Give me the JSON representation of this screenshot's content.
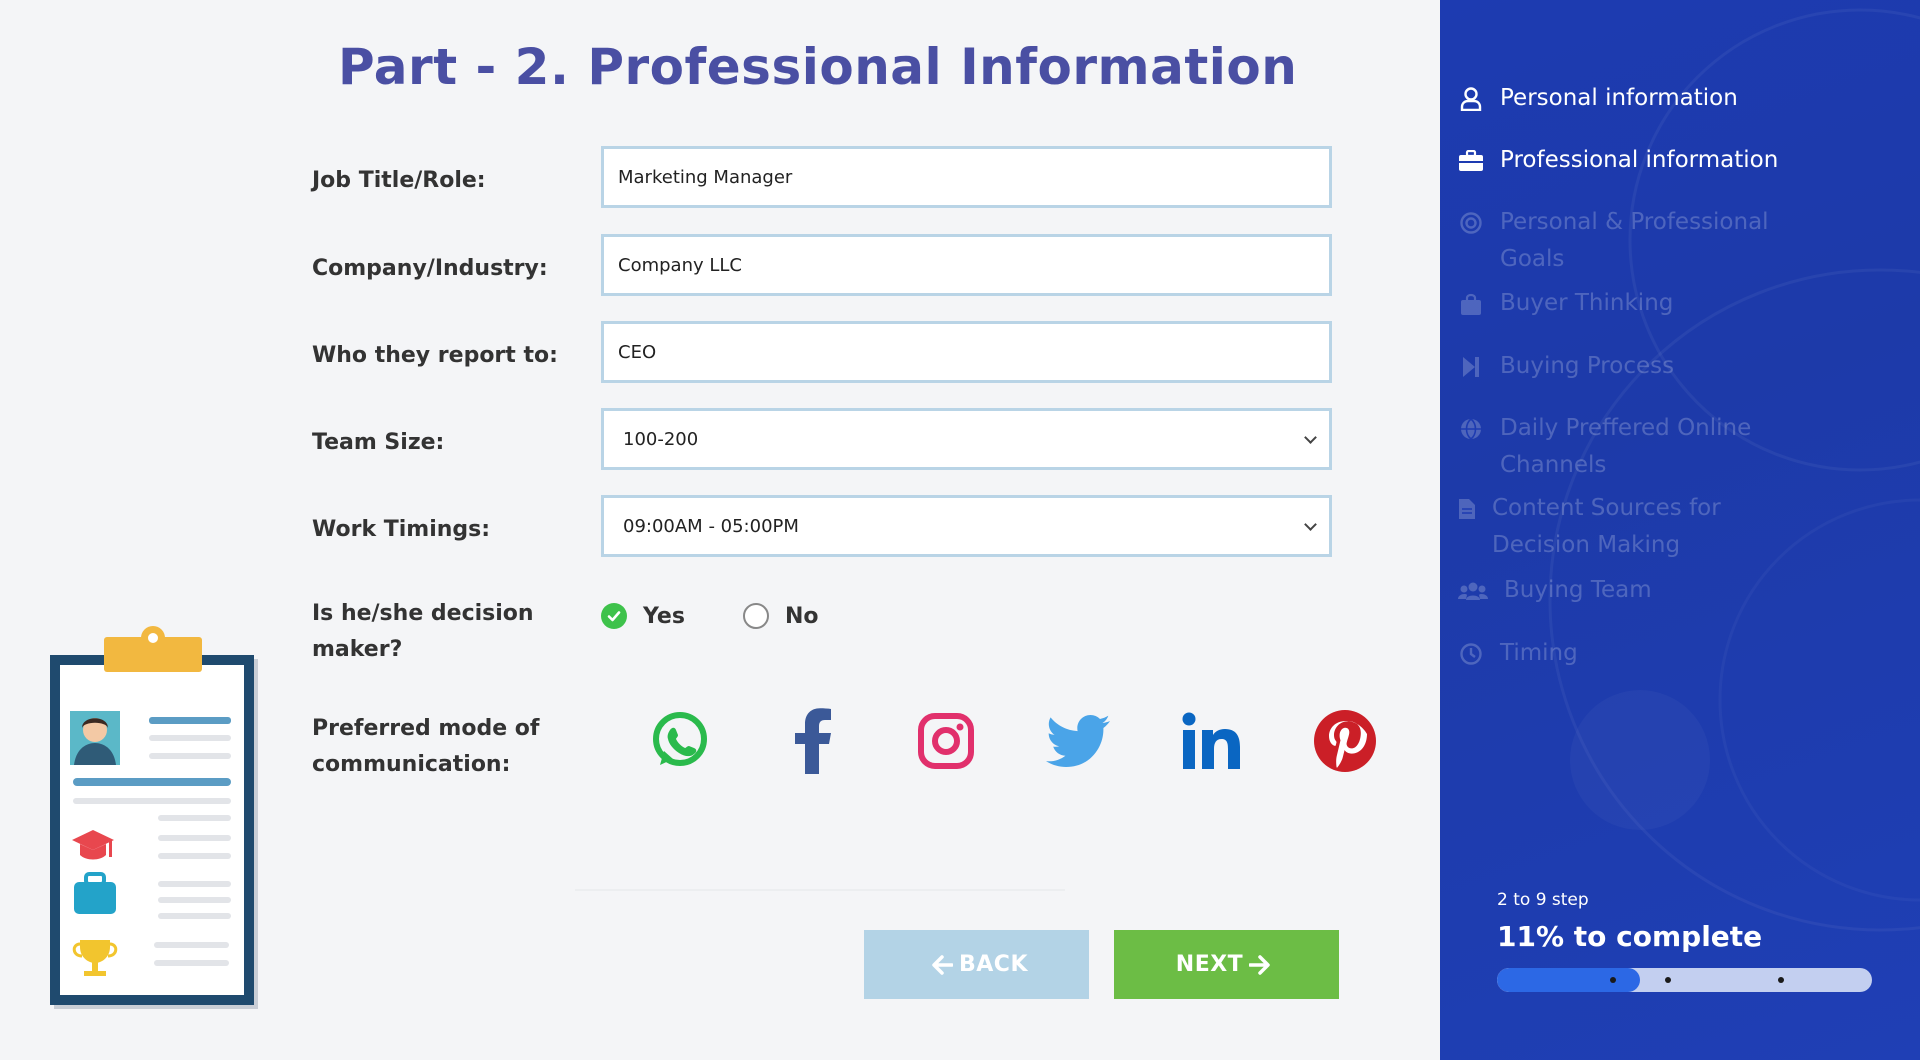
{
  "page": {
    "title": "Part - 2. Professional Information"
  },
  "form": {
    "job_title": {
      "label": "Job Title/Role:",
      "value": "Marketing Manager"
    },
    "company": {
      "label": "Company/Industry:",
      "value": "Company LLC"
    },
    "report_to": {
      "label": "Who they report to:",
      "value": "CEO"
    },
    "team_size": {
      "label": "Team Size:",
      "value": "100-200"
    },
    "work_timings": {
      "label": "Work Timings:",
      "value": "09:00AM - 05:00PM"
    },
    "decision_maker": {
      "label": "Is he/she decision maker?",
      "options": [
        "Yes",
        "No"
      ],
      "selected": "Yes"
    },
    "communication": {
      "label": "Preferred mode of communication:",
      "icons": [
        "whatsapp-icon",
        "facebook-icon",
        "instagram-icon",
        "twitter-icon",
        "linkedin-icon",
        "pinterest-icon"
      ]
    }
  },
  "buttons": {
    "back": "BACK",
    "next": "NEXT"
  },
  "sidebar": {
    "items": [
      {
        "label": "Personal information",
        "icon": "user-icon",
        "state": "active"
      },
      {
        "label": "Professional information",
        "icon": "briefcase-icon",
        "state": "active"
      },
      {
        "label": "Personal & Professional Goals",
        "icon": "target-icon",
        "state": "inactive"
      },
      {
        "label": "Buyer Thinking",
        "icon": "shopping-bag-icon",
        "state": "inactive"
      },
      {
        "label": "Buying Process",
        "icon": "step-forward-icon",
        "state": "inactive"
      },
      {
        "label": "Daily Preffered Online Channels",
        "icon": "globe-icon",
        "state": "inactive"
      },
      {
        "label": "Content Sources for Decision Making",
        "icon": "document-icon",
        "state": "inactive"
      },
      {
        "label": "Buying Team",
        "icon": "users-icon",
        "state": "inactive"
      },
      {
        "label": "Timing",
        "icon": "clock-icon",
        "state": "inactive"
      }
    ],
    "progress": {
      "step_text": "2 to 9 step",
      "complete_text": "11% to complete",
      "fraction": 0.38
    }
  },
  "colors": {
    "title": "#4a4fa3",
    "sidebar_bg": "#1d3bb1",
    "next_button": "#6cbd45",
    "back_button": "#b3d3e6",
    "field_border": "#b9d4e6",
    "radio_checked": "#3ec24b",
    "progress_fill": "#2c68e5"
  }
}
